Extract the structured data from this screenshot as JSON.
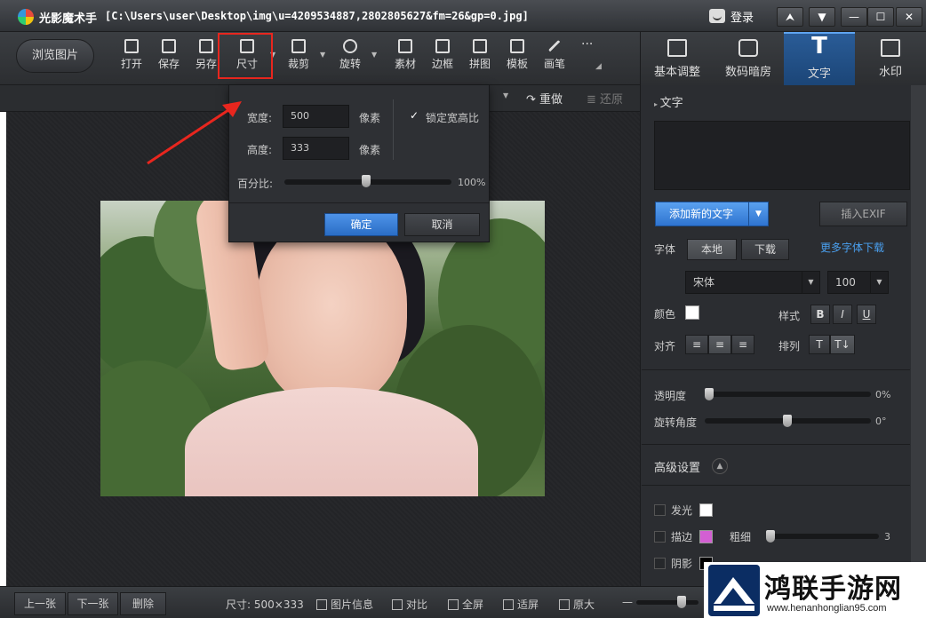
{
  "window": {
    "app_name": "光影魔术手",
    "file_path": "[C:\\Users\\user\\Desktop\\img\\u=4209534887,2802805627&fm=26&gp=0.jpg]",
    "login_label": "登录",
    "controls": [
      "⮝",
      "▼",
      "—",
      "☐",
      "✕"
    ]
  },
  "toolbar": {
    "browse_label": "浏览图片",
    "tools": [
      {
        "label": "打开",
        "icon": "open-image-icon"
      },
      {
        "label": "保存",
        "icon": "save-icon"
      },
      {
        "label": "另存",
        "icon": "save-as-icon"
      },
      {
        "label": "尺寸",
        "icon": "resize-icon"
      },
      {
        "label": "裁剪",
        "icon": "crop-icon"
      },
      {
        "label": "旋转",
        "icon": "rotate-icon"
      },
      {
        "label": "素材",
        "icon": "material-icon"
      },
      {
        "label": "边框",
        "icon": "frame-icon"
      },
      {
        "label": "拼图",
        "icon": "collage-icon"
      },
      {
        "label": "模板",
        "icon": "template-icon"
      },
      {
        "label": "画笔",
        "icon": "brush-icon"
      }
    ],
    "more_label": "···"
  },
  "subbar": {
    "redo_label": "重做",
    "undo_label": "还原"
  },
  "size_dialog": {
    "width_label": "宽度:",
    "width_value": "500",
    "width_unit": "像素",
    "height_label": "高度:",
    "height_value": "333",
    "height_unit": "像素",
    "lock_label": "锁定宽高比",
    "lock_checked": true,
    "percent_label": "百分比:",
    "percent_value": "100%",
    "percent_fraction": 0.5,
    "ok_label": "确定",
    "cancel_label": "取消"
  },
  "right_tabs": [
    {
      "label": "基本调整",
      "icon": "basic-adjust-icon"
    },
    {
      "label": "数码暗房",
      "icon": "camera-icon"
    },
    {
      "label": "文字",
      "icon": "text-t-icon",
      "active": true
    },
    {
      "label": "水印",
      "icon": "watermark-add-icon"
    }
  ],
  "text_panel": {
    "section_title": "文字",
    "add_text_label": "添加新的文字",
    "insert_exif_label": "插入EXIF",
    "font_label": "字体",
    "font_source_local": "本地",
    "font_source_download": "下载",
    "more_fonts_label": "更多字体下载",
    "font_family_value": "宋体",
    "font_size_value": "100",
    "color_label": "颜色",
    "style_label": "样式",
    "style_buttons": [
      "B",
      "I",
      "U"
    ],
    "align_label": "对齐",
    "arrange_label": "排列",
    "opacity_label": "透明度",
    "opacity_value": "0%",
    "rotation_label": "旋转角度",
    "rotation_value": "0°",
    "advanced_label": "高级设置",
    "glow_label": "发光",
    "stroke_label": "描边",
    "thickness_label": "粗细",
    "thickness_value": "3",
    "shadow_label": "阴影",
    "colors": {
      "text": "#ffffff",
      "glow": "#ffffff",
      "stroke": "#d35fd3",
      "shadow": "#000000"
    }
  },
  "bottom_bar": {
    "prev_label": "上一张",
    "next_label": "下一张",
    "delete_label": "删除",
    "size_info": "尺寸: 500×333",
    "image_info_label": "图片信息",
    "compare_label": "对比",
    "fullscreen_label": "全屏",
    "fit_label": "适屏",
    "original_label": "原大"
  },
  "watermark": {
    "title": "鸿联手游网",
    "url": "www.henanhonglian95.com"
  },
  "accent_colors": {
    "highlight_red": "#e8261e",
    "primary_blue": "#2f74d0",
    "link_blue": "#4aa0f0"
  }
}
